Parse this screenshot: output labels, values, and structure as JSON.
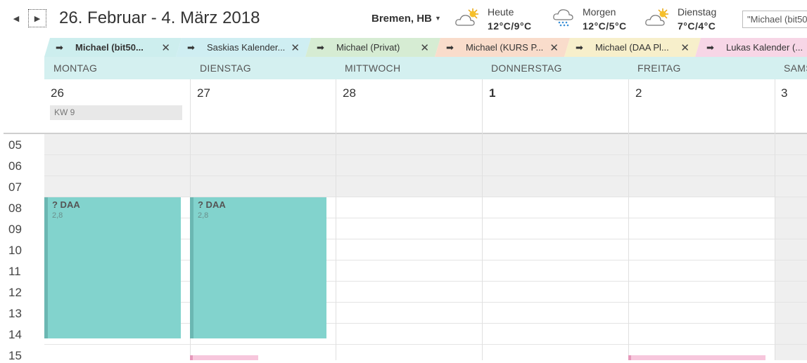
{
  "header": {
    "date_range": "26. Februar - 4. März 2018",
    "prev_icon": "◀",
    "next_icon": "▶",
    "location": "Bremen, HB",
    "search_placeholder": "\"Michael (bit50"
  },
  "weather": [
    {
      "day": "Heute",
      "temp": "12°C/9°C",
      "icon": "sun-cloud-icon"
    },
    {
      "day": "Morgen",
      "temp": "12°C/5°C",
      "icon": "snow-cloud-icon"
    },
    {
      "day": "Dienstag",
      "temp": "7°C/4°C",
      "icon": "sun-cloud-icon"
    }
  ],
  "tabs": [
    {
      "label": "Michael (bit50...",
      "color": "#cdeeee",
      "bold": true
    },
    {
      "label": "Saskias Kalender...",
      "color": "#cfeef2"
    },
    {
      "label": "Michael (Privat)",
      "color": "#d6ecd3"
    },
    {
      "label": "Michael (KURS P...",
      "color": "#f9dccb"
    },
    {
      "label": "Michael (DAA Pl...",
      "color": "#f7efcb"
    },
    {
      "label": "Lukas Kalender (...",
      "color": "#f7d6e6"
    }
  ],
  "days": [
    {
      "name": "MONTAG",
      "date": "26"
    },
    {
      "name": "DIENSTAG",
      "date": "27"
    },
    {
      "name": "MITTWOCH",
      "date": "28"
    },
    {
      "name": "DONNERSTAG",
      "date": "1"
    },
    {
      "name": "FREITAG",
      "date": "2"
    },
    {
      "name": "SAMSTAG",
      "date": "3"
    }
  ],
  "week_label": "KW 9",
  "hours": [
    "05",
    "06",
    "07",
    "08",
    "09",
    "10",
    "11",
    "12",
    "13",
    "14",
    "15"
  ],
  "events": [
    {
      "title": "? DAA",
      "sub": "2,8"
    },
    {
      "title": "? DAA",
      "sub": "2,8"
    }
  ],
  "colors": {
    "event": "#82d3cd",
    "day_band": "#d4f0f0",
    "pink_event": "#f7c6dc"
  }
}
